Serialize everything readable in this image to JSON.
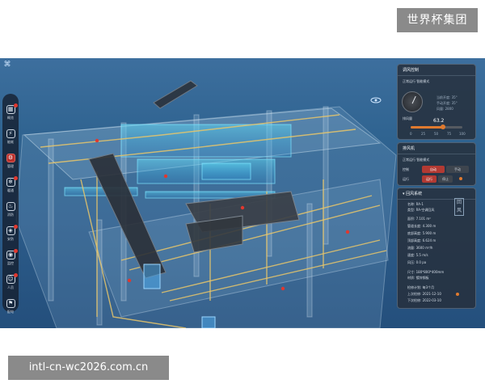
{
  "brand_tag": "世界杯集团",
  "url_tag": "intl-cn-wc2026.com.cn",
  "toolbar": {
    "items": [
      {
        "label": "概览",
        "icon": "dashboard-icon",
        "badge": true,
        "active": false
      },
      {
        "label": "能耗",
        "icon": "energy-icon",
        "badge": false,
        "active": false
      },
      {
        "label": "管理",
        "icon": "manage-icon",
        "badge": false,
        "active": true
      },
      {
        "label": "暖通",
        "icon": "hvac-icon",
        "badge": true,
        "active": false
      },
      {
        "label": "消防",
        "icon": "fire-icon",
        "badge": false,
        "active": false
      },
      {
        "label": "安防",
        "icon": "security-icon",
        "badge": true,
        "active": false
      },
      {
        "label": "监控",
        "icon": "camera-icon",
        "badge": true,
        "active": false
      },
      {
        "label": "人员",
        "icon": "people-icon",
        "badge": true,
        "active": false
      },
      {
        "label": "配电",
        "icon": "power-icon",
        "badge": false,
        "active": false
      },
      {
        "label": "资产",
        "icon": "asset-icon",
        "badge": false,
        "active": false
      },
      {
        "label": "退出",
        "icon": "logout-icon",
        "badge": false,
        "active": false
      }
    ]
  },
  "panel_valve": {
    "title": "调风控制",
    "mode": "正常运行 智能模式",
    "readout_1": "当前开度: 35°",
    "readout_2": "手动开度: 35°",
    "readout_3": "风量: 2800",
    "gauge_label": "排风量",
    "value": "63.2",
    "slider_percent": 63,
    "ticks": [
      "0",
      "25",
      "50",
      "75",
      "100"
    ]
  },
  "panel_fan": {
    "title": "排风机",
    "mode": "正常运行 智能模式",
    "control_label": "控制",
    "control_options": [
      "自动",
      "手动"
    ],
    "control_active": 0,
    "switch_label": "运行",
    "switch_options": [
      "运行",
      "停止"
    ],
    "switch_active": 0
  },
  "panel_system": {
    "title": "回风系统",
    "tag": "回风",
    "name": "名称: RA-1",
    "type": "类型: RA-空调回风",
    "area": "面积: 7.101 m²",
    "length": "管道长度: 4.300 m",
    "height": "底部高度: 5.900 m",
    "top_height": "顶部高度: 6.624 m",
    "flow": "流量: 3600 m³/h",
    "speed": "速度: 5.5 m/s",
    "pressure": "风压: 0.0 pa",
    "size": "尺寸: 180*800*400mm",
    "material": "材质: 镀锌钢板",
    "maint_plan": "检修计划: 每3个月",
    "last_check": "上次检修: 2021-12-10",
    "next_check": "下次检修: 2022-03-10"
  },
  "colors": {
    "accent": "#e07a2f",
    "active_red": "#b23a33",
    "duct_yellow": "#e8c66a",
    "duct_cyan": "#5fd4f0"
  }
}
